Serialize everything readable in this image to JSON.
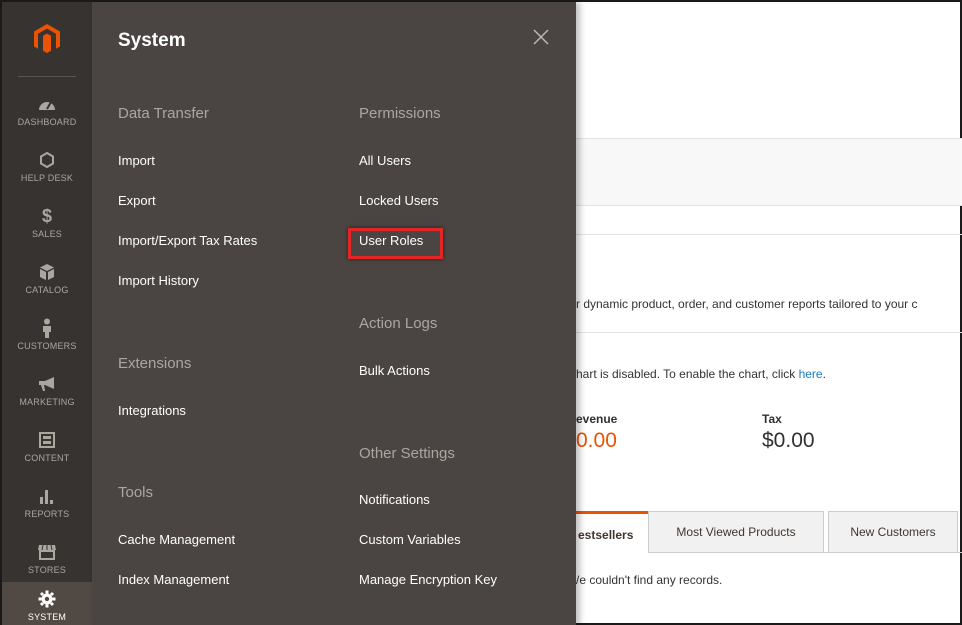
{
  "sidebar": {
    "items": [
      {
        "label": "DASHBOARD",
        "icon": "dashboard-icon"
      },
      {
        "label": "HELP DESK",
        "icon": "hexagon-icon"
      },
      {
        "label": "SALES",
        "icon": "dollar-icon"
      },
      {
        "label": "CATALOG",
        "icon": "box-icon"
      },
      {
        "label": "CUSTOMERS",
        "icon": "person-icon"
      },
      {
        "label": "MARKETING",
        "icon": "megaphone-icon"
      },
      {
        "label": "CONTENT",
        "icon": "layout-icon"
      },
      {
        "label": "REPORTS",
        "icon": "bar-chart-icon"
      },
      {
        "label": "STORES",
        "icon": "store-icon"
      },
      {
        "label": "SYSTEM",
        "icon": "gear-icon"
      }
    ],
    "active": "SYSTEM"
  },
  "flyout": {
    "title": "System",
    "sections": {
      "data_transfer": {
        "title": "Data Transfer",
        "links": [
          "Import",
          "Export",
          "Import/Export Tax Rates",
          "Import History"
        ]
      },
      "extensions": {
        "title": "Extensions",
        "links": [
          "Integrations"
        ]
      },
      "tools": {
        "title": "Tools",
        "links": [
          "Cache Management",
          "Index Management"
        ]
      },
      "permissions": {
        "title": "Permissions",
        "links": [
          "All Users",
          "Locked Users",
          "User Roles"
        ]
      },
      "action_logs": {
        "title": "Action Logs",
        "links": [
          "Bulk Actions"
        ]
      },
      "other_settings": {
        "title": "Other Settings",
        "links": [
          "Notifications",
          "Custom Variables",
          "Manage Encryption Key"
        ]
      }
    },
    "highlighted_link": "User Roles"
  },
  "content": {
    "reports_text": "r dynamic product, order, and customer reports tailored to your c",
    "chart_disabled_text": "hart is disabled. To enable the chart, click ",
    "chart_link": "here",
    "chart_text_end": ".",
    "revenue_label": "evenue",
    "revenue_value": "0.00",
    "tax_label": "Tax",
    "tax_value": "$0.00",
    "tabs": [
      "estsellers",
      "Most Viewed Products",
      "New Customers"
    ],
    "empty_text": "/e couldn't find any records."
  },
  "colors": {
    "sidebar_bg": "#373330",
    "flyout_bg": "#4a4542",
    "accent": "#eb5202",
    "highlight": "#e22626",
    "link": "#1979c3"
  }
}
